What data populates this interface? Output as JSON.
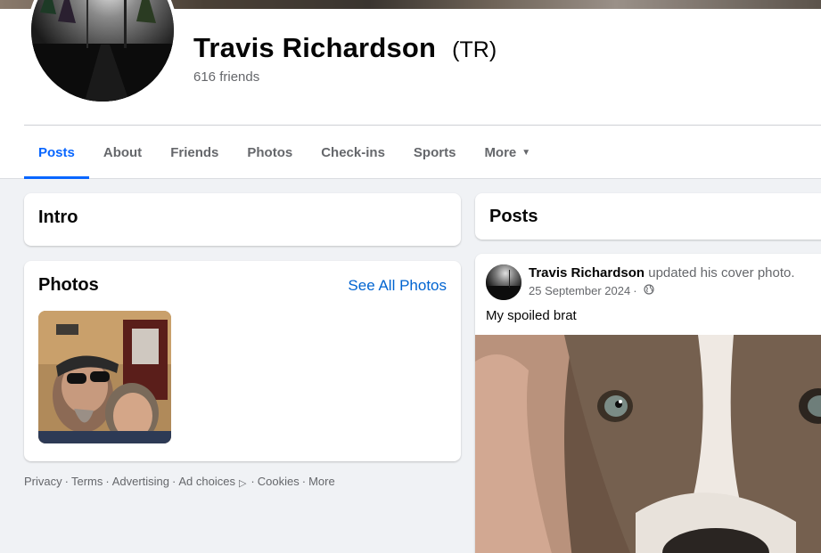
{
  "profile": {
    "name": "Travis Richardson",
    "alternate_name": "(TR)",
    "friends": "616 friends"
  },
  "tabs": [
    {
      "label": "Posts",
      "active": true
    },
    {
      "label": "About"
    },
    {
      "label": "Friends"
    },
    {
      "label": "Photos"
    },
    {
      "label": "Check-ins"
    },
    {
      "label": "Sports"
    },
    {
      "label": "More"
    }
  ],
  "intro": {
    "title": "Intro"
  },
  "photos_section": {
    "title": "Photos",
    "see_all": "See All Photos"
  },
  "footer": {
    "privacy": "Privacy",
    "terms": "Terms",
    "advertising": "Advertising",
    "ad_choices": "Ad choices",
    "cookies": "Cookies",
    "more": "More",
    "separator": "·"
  },
  "posts_section": {
    "title": "Posts"
  },
  "post": {
    "author": "Travis Richardson",
    "action": "updated his cover photo.",
    "date": "25 September 2024",
    "date_separator": "·",
    "text": "My spoiled brat"
  },
  "colors": {
    "accent": "#0866ff",
    "link": "#0064d1",
    "background": "#f0f2f5",
    "secondary_text": "#65676b"
  },
  "icons": {
    "tab_more": "caret-down-icon",
    "privacy": "globe-icon",
    "ad_choices": "ad-choices-icon"
  }
}
